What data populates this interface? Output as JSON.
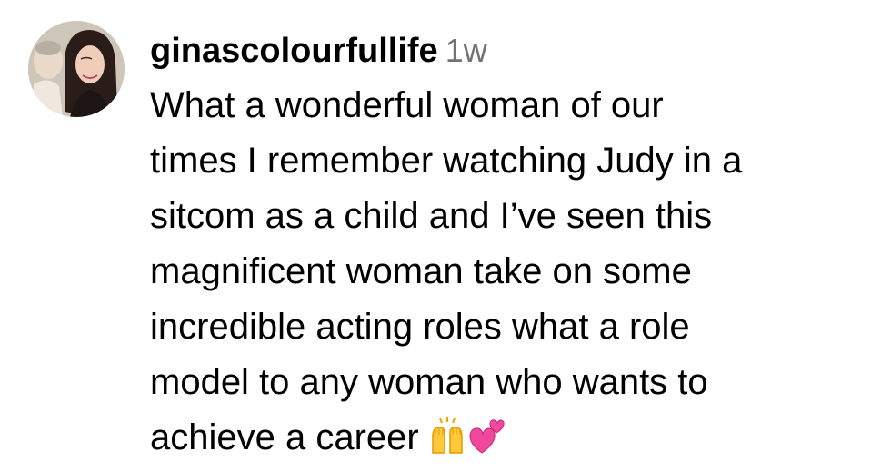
{
  "comment": {
    "username": "ginascolourfullife",
    "timestamp": "1w",
    "text_lines": [
      "What a wonderful woman of our",
      "times I remember watching Judy in a",
      "sitcom as a child and I’ve seen this",
      "magnificent woman take on some",
      "incredible acting roles what a role",
      "model to any woman who wants to",
      "achieve a career"
    ],
    "emojis": [
      "raising-hands-icon",
      "two-hearts-icon"
    ]
  }
}
